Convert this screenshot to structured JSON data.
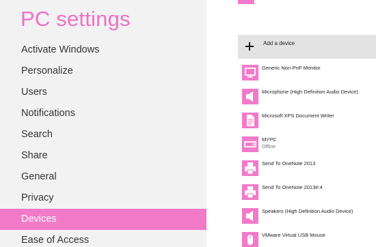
{
  "page": {
    "title": "PC settings"
  },
  "nav": {
    "items": [
      {
        "label": "Activate Windows"
      },
      {
        "label": "Personalize"
      },
      {
        "label": "Users"
      },
      {
        "label": "Notifications"
      },
      {
        "label": "Search"
      },
      {
        "label": "Share"
      },
      {
        "label": "General"
      },
      {
        "label": "Privacy"
      },
      {
        "label": "Devices",
        "selected": true
      },
      {
        "label": "Ease of Access"
      }
    ]
  },
  "devices": {
    "add_label": "Add a device",
    "items": [
      {
        "name": "Generic Non-PnP Monitor",
        "icon": "monitor-icon"
      },
      {
        "name": "Microphone (High Definition Audio Device)",
        "icon": "speaker-icon"
      },
      {
        "name": "Microsoft XPS Document Writer",
        "icon": "document-icon"
      },
      {
        "name": "MYPC",
        "status": "Offline",
        "icon": "pc-icon"
      },
      {
        "name": "Send To OneNote 2013",
        "icon": "printer-icon"
      },
      {
        "name": "Send To OneNote 2013#:4",
        "icon": "printer-icon"
      },
      {
        "name": "Speakers (High Definition Audio Device)",
        "icon": "speaker-icon"
      },
      {
        "name": "VMware Virtual USB Mouse",
        "icon": "mouse-icon"
      }
    ]
  },
  "colors": {
    "accent": "#f27ac8",
    "title": "#f070c4",
    "left_background": "#f2f2f2",
    "add_device_background": "#e3e3e3"
  }
}
